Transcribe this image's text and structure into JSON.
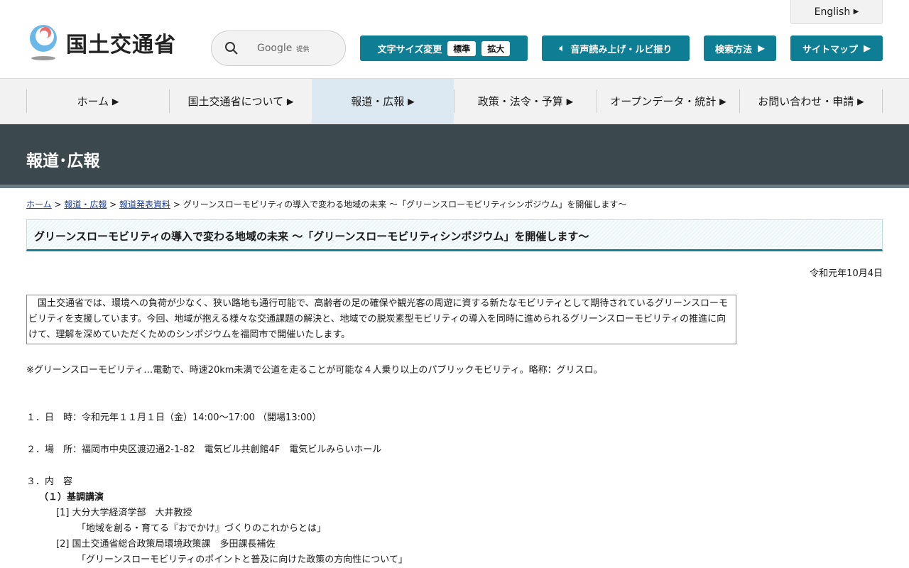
{
  "header": {
    "logo_text": "国土交通省",
    "search_brand": "Google",
    "search_provided": "提供",
    "font_size_label": "文字サイズ変更",
    "font_standard": "標準",
    "font_large": "拡大",
    "speech": "音声読み上げ・ルビ振り",
    "search_method": "検索方法",
    "sitemap": "サイトマップ",
    "english": "English"
  },
  "nav": [
    "ホーム",
    "国土交通省について",
    "報道・広報",
    "政策・法令・予算",
    "オープンデータ・統計",
    "お問い合わせ・申請"
  ],
  "banner": "報道･広報",
  "breadcrumb": {
    "items": [
      "ホーム",
      "報道・広報",
      "報道発表資料"
    ],
    "current": "グリーンスローモビリティの導入で変わる地域の未来 ～「グリーンスローモビリティシンポジウム」を開催します～"
  },
  "title": "グリーンスローモビリティの導入で変わる地域の未来 ～「グリーンスローモビリティシンポジウム」を開催します～",
  "date": "令和元年10月4日",
  "intro": "　国土交通省では、環境への負荷が少なく、狭い路地も通行可能で、高齢者の足の確保や観光客の周遊に資する新たなモビリティとして期待されているグリーンスローモビリティを支援しています。今回、地域が抱える様々な交通課題の解決と、地域での脱炭素型モビリティの導入を同時に進められるグリーンスローモビリティの推進に向けて、理解を深めていただくためのシンポジウムを福岡市で開催いたします。",
  "note": "※グリーンスローモビリティ…電動で、時速20km未満で公道を走ることが可能な４人乗り以上のパブリックモビリティ。略称：グリスロ。",
  "items": {
    "date": "１．日　時：令和元年１１月１日（金）14:00～17:00 （開場13:00）",
    "place": "２．場　所：福岡市中央区渡辺通2-1-82　電気ビル共創館4F　電気ビルみらいホール",
    "content": "３．内　容",
    "keynote": "（１）基調講演",
    "s1": "[1] 大分大学経済学部　大井教授",
    "s1t": "「地域を創る・育てる『おでかけ』づくりのこれからとは」",
    "s2": "[2] 国土交通省総合政策局環境政策課　多田課長補佐",
    "s2t": "「グリーンスローモビリティのポイントと普及に向けた政策の方向性について」"
  },
  "colors": {
    "accent": "#0e7e95",
    "banner": "#3b494f"
  }
}
